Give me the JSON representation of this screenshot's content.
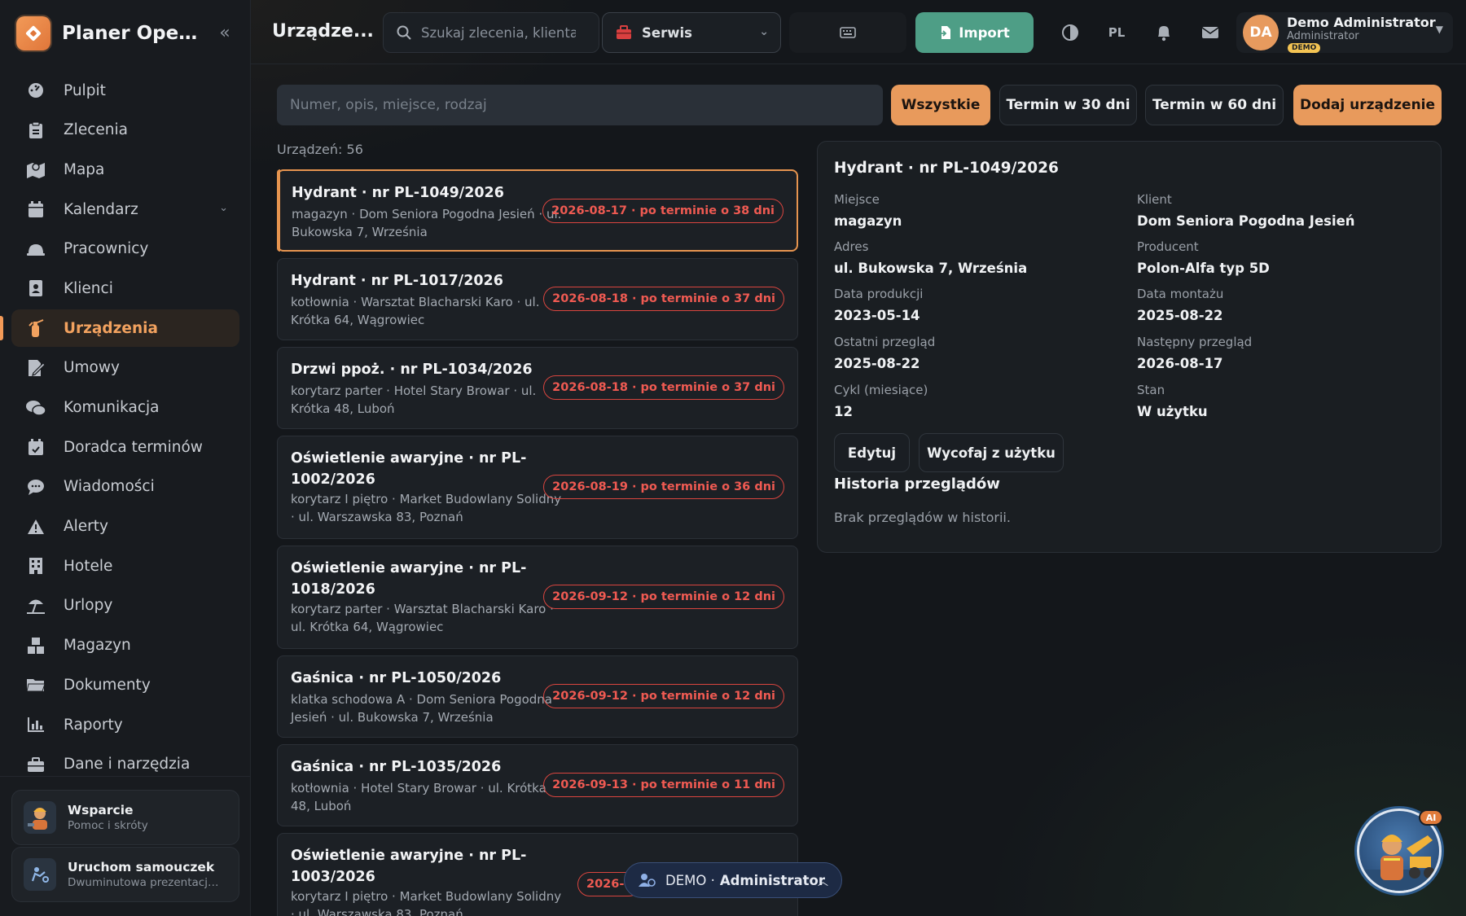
{
  "app": {
    "title": "Planer Oper..."
  },
  "sidebar": {
    "items": [
      {
        "label": "Pulpit",
        "icon": "dashboard-icon"
      },
      {
        "label": "Zlecenia",
        "icon": "clipboard-icon"
      },
      {
        "label": "Mapa",
        "icon": "map-icon"
      },
      {
        "label": "Kalendarz",
        "icon": "calendar-icon"
      },
      {
        "label": "Pracownicy",
        "icon": "helmet-icon"
      },
      {
        "label": "Klienci",
        "icon": "contacts-icon"
      },
      {
        "label": "Urządzenia",
        "icon": "fire-extinguisher-icon"
      },
      {
        "label": "Umowy",
        "icon": "contract-icon"
      },
      {
        "label": "Komunikacja",
        "icon": "chat-icon"
      },
      {
        "label": "Doradca terminów",
        "icon": "calendar-check-icon"
      },
      {
        "label": "Wiadomości",
        "icon": "message-icon"
      },
      {
        "label": "Alerty",
        "icon": "warning-icon"
      },
      {
        "label": "Hotele",
        "icon": "hotel-icon"
      },
      {
        "label": "Urlopy",
        "icon": "beach-icon"
      },
      {
        "label": "Magazyn",
        "icon": "boxes-icon"
      },
      {
        "label": "Dokumenty",
        "icon": "folder-icon"
      },
      {
        "label": "Raporty",
        "icon": "chart-icon"
      },
      {
        "label": "Dane i narzędzia",
        "icon": "toolbox-icon"
      }
    ],
    "active": "Urządzenia",
    "support": {
      "title": "Wsparcie",
      "subtitle": "Pomoc i skróty"
    },
    "tutorial": {
      "title": "Uruchom samouczek",
      "subtitle": "Dwuminutowa prezentacja ..."
    }
  },
  "header": {
    "page_title": "Urządze...",
    "search_placeholder": "Szukaj zlecenia, klienta, ...",
    "service_select": "Serwis",
    "import_label": "Import",
    "lang": "PL",
    "user": {
      "initials": "DA",
      "name": "Demo Administrator",
      "role": "Administrator",
      "badge": "DEMO"
    }
  },
  "filters": {
    "placeholder": "Numer, opis, miejsce, rodzaj",
    "buttons": [
      "Wszystkie",
      "Termin w 30 dni",
      "Termin w 60 dni",
      "Dodaj urządzenie"
    ]
  },
  "device_count": "Urządzeń: 56",
  "devices": [
    {
      "title": "Hydrant · nr PL-1049/2026",
      "sub": "magazyn · Dom Seniora Pogodna Jesień · ul. Bukowska 7, Września",
      "due": "2026-08-17 · po terminie o 38 dni"
    },
    {
      "title": "Hydrant · nr PL-1017/2026",
      "sub": "kotłownia · Warsztat Blacharski Karo · ul. Krótka 64, Wągrowiec",
      "due": "2026-08-18 · po terminie o 37 dni"
    },
    {
      "title": "Drzwi ppoż. · nr PL-1034/2026",
      "sub": "korytarz parter · Hotel Stary Browar · ul. Krótka 48, Luboń",
      "due": "2026-08-18 · po terminie o 37 dni"
    },
    {
      "title": "Oświetlenie awaryjne · nr PL-1002/2026",
      "sub": "korytarz I piętro · Market Budowlany Solidny · ul. Warszawska 83, Poznań",
      "due": "2026-08-19 · po terminie o 36 dni"
    },
    {
      "title": "Oświetlenie awaryjne · nr PL-1018/2026",
      "sub": "korytarz parter · Warsztat Blacharski Karo · ul. Krótka 64, Wągrowiec",
      "due": "2026-09-12 · po terminie o 12 dni"
    },
    {
      "title": "Gaśnica · nr PL-1050/2026",
      "sub": "klatka schodowa A · Dom Seniora Pogodna Jesień · ul. Bukowska 7, Września",
      "due": "2026-09-12 · po terminie o 12 dni"
    },
    {
      "title": "Gaśnica · nr PL-1035/2026",
      "sub": "kotłownia · Hotel Stary Browar · ul. Krótka 48, Luboń",
      "due": "2026-09-13 · po terminie o 11 dni"
    },
    {
      "title": "Oświetlenie awaryjne · nr PL-1003/2026",
      "sub": "korytarz I piętro · Market Budowlany Solidny · ul. Warszawska 83, Poznań",
      "due": "2026-0"
    }
  ],
  "detail": {
    "title": "Hydrant · nr PL-1049/2026",
    "fields": [
      {
        "label": "Miejsce",
        "value": "magazyn"
      },
      {
        "label": "Klient",
        "value": "Dom Seniora Pogodna Jesień"
      },
      {
        "label": "Adres",
        "value": "ul. Bukowska 7, Września"
      },
      {
        "label": "Producent",
        "value": "Polon-Alfa typ 5D"
      },
      {
        "label": "Data produkcji",
        "value": "2023-05-14"
      },
      {
        "label": "Data montażu",
        "value": "2025-08-22"
      },
      {
        "label": "Ostatni przegląd",
        "value": "2025-08-22"
      },
      {
        "label": "Następny przegląd",
        "value": "2026-08-17"
      },
      {
        "label": "Cykl (miesiące)",
        "value": "12"
      },
      {
        "label": "Stan",
        "value": "W użytku"
      }
    ],
    "edit_label": "Edytuj",
    "retire_label": "Wycofaj z użytku",
    "history_title": "Historia przeglądów",
    "history_empty": "Brak przeglądów w historii."
  },
  "demo_pill": {
    "prefix": "DEMO · ",
    "role": "Administrator"
  },
  "ai_badge": "AI",
  "colors": {
    "accent": "#e89a5c",
    "import": "#4e9e86",
    "danger": "#ef5a52",
    "demo": "#f4c453"
  }
}
